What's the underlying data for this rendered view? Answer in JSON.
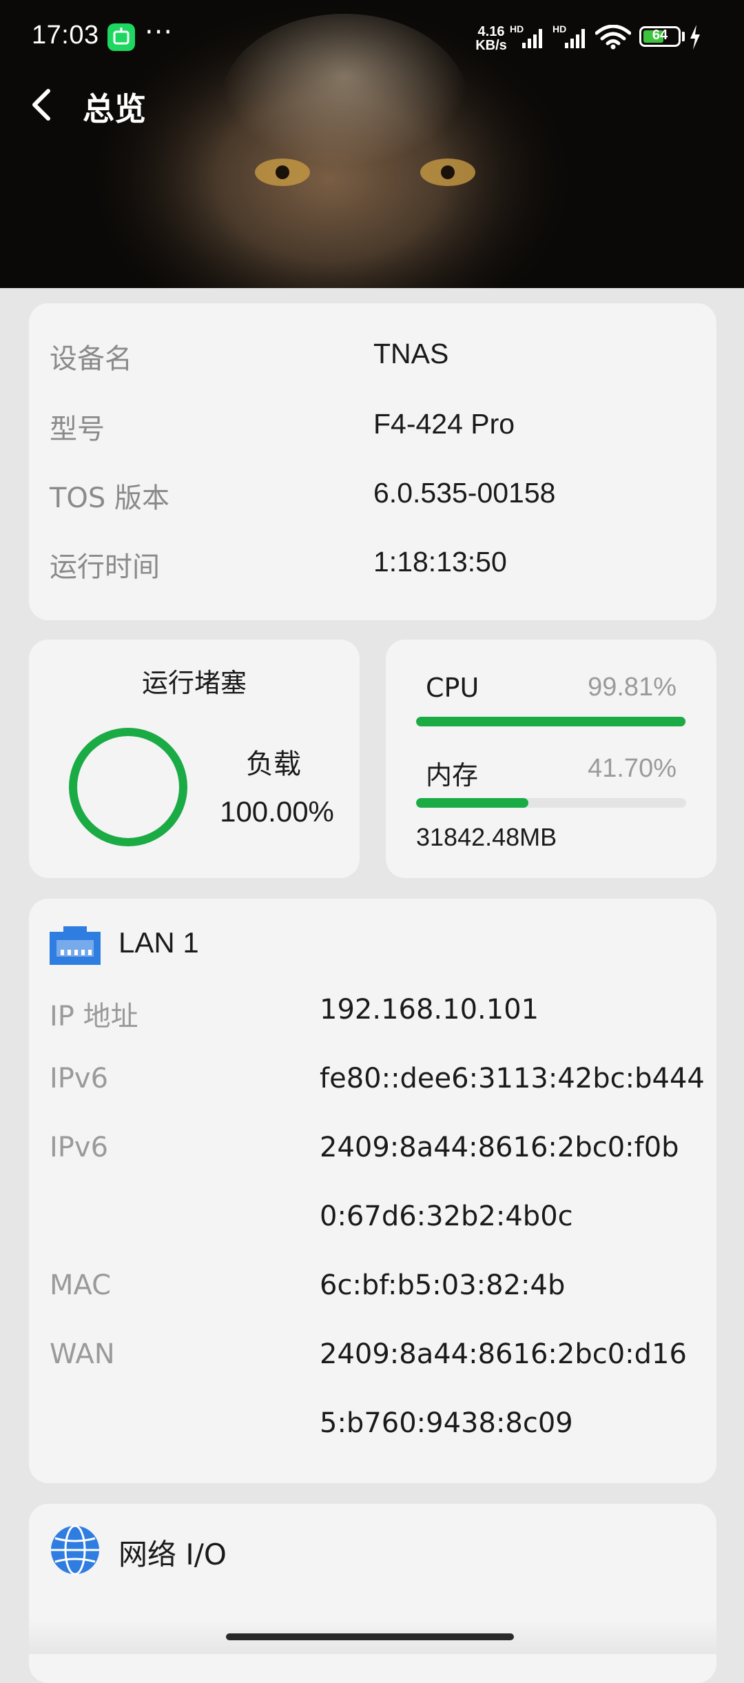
{
  "status_bar": {
    "time": "17:03",
    "dots": "···",
    "net_speed_value": "4.16",
    "net_speed_unit": "KB/s",
    "signal_label": "HD",
    "battery": "64",
    "battery_level_percent": 64
  },
  "header": {
    "title": "总览"
  },
  "device_info": [
    {
      "label": "设备名",
      "value": "TNAS"
    },
    {
      "label": "型号",
      "value": "F4-424 Pro"
    },
    {
      "label": "TOS 版本",
      "value": "6.0.535-00158"
    },
    {
      "label": "运行时间",
      "value": "1:18:13:50"
    }
  ],
  "congestion": {
    "title": "运行堵塞",
    "load_label": "负载",
    "load_value": "100.00%",
    "load_percent": 100
  },
  "resources": {
    "cpu_label": "CPU",
    "cpu_value": "99.81%",
    "cpu_percent": 99.81,
    "mem_label": "内存",
    "mem_value": "41.70%",
    "mem_percent": 41.7,
    "mem_size": "31842.48MB"
  },
  "lan": {
    "title": "LAN 1",
    "ip_label": "IP 地址",
    "ip_value": "192.168.10.101",
    "ipv6_label_1": "IPv6",
    "ipv6_value_1": "fe80::dee6:3113:42bc:b444",
    "ipv6_label_2": "IPv6",
    "ipv6_value_2a": "2409:8a44:8616:2bc0:f0b",
    "ipv6_value_2b": "0:67d6:32b2:4b0c",
    "mac_label": "MAC",
    "mac_value": "6c:bf:b5:03:82:4b",
    "wan_label": "WAN",
    "wan_value_a": "2409:8a44:8616:2bc0:d16",
    "wan_value_b": "5:b760:9438:8c09"
  },
  "network_io": {
    "title": "网络 I/O"
  },
  "colors": {
    "accent_green": "#1aab45",
    "card_bg": "#f4f4f4",
    "page_bg": "#e6e6e6",
    "label_gray": "#9a9a9a",
    "lan_blue": "#2f7de1"
  },
  "icons": {
    "back": "chevron-left-icon",
    "lan": "ethernet-port-icon",
    "network": "globe-icon"
  }
}
